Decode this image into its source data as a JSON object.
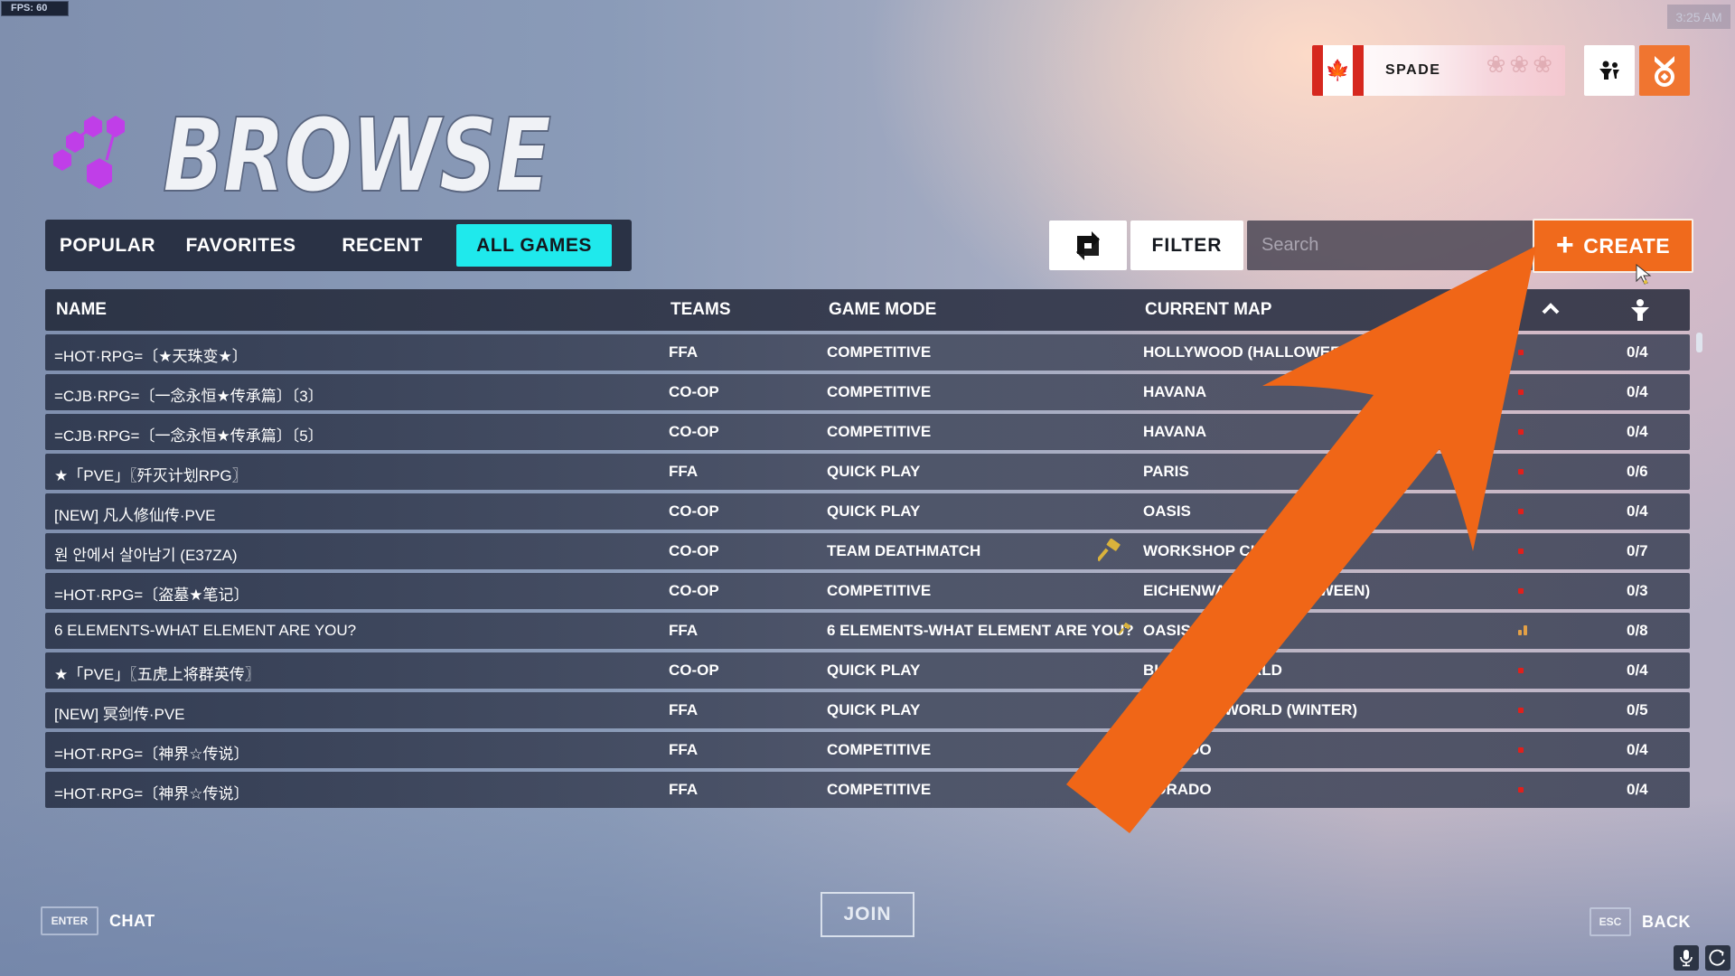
{
  "hud": {
    "fps": "FPS:  60",
    "clock": "3:25 AM"
  },
  "header": {
    "title": "BROWSE"
  },
  "player": {
    "name": "SPADE",
    "flag": "canada-flag"
  },
  "tabs": [
    {
      "label": "POPULAR",
      "active": false
    },
    {
      "label": "FAVORITES",
      "active": false
    },
    {
      "label": "RECENT",
      "active": false
    },
    {
      "label": "ALL GAMES",
      "active": true
    }
  ],
  "toolbar": {
    "filter_label": "FILTER",
    "search_placeholder": "Search",
    "search_value": "",
    "create_label": "CREATE"
  },
  "table": {
    "columns": {
      "name": "NAME",
      "teams": "TEAMS",
      "mode": "GAME MODE",
      "map": "CURRENT MAP"
    },
    "rows": [
      {
        "name": "=HOT·RPG=〔★天珠变★〕",
        "teams": "FFA",
        "mode": "COMPETITIVE",
        "map": "HOLLYWOOD (HALLOWEEN)",
        "ping": "bad",
        "players": "0/4",
        "workshop": false
      },
      {
        "name": "=CJB·RPG=〔一念永恒★传承篇〕〔3〕",
        "teams": "CO-OP",
        "mode": "COMPETITIVE",
        "map": "HAVANA",
        "ping": "bad",
        "players": "0/4",
        "workshop": false
      },
      {
        "name": "=CJB·RPG=〔一念永恒★传承篇〕〔5〕",
        "teams": "CO-OP",
        "mode": "COMPETITIVE",
        "map": "HAVANA",
        "ping": "bad",
        "players": "0/4",
        "workshop": false
      },
      {
        "name": "★「PVE」〖歼灭计划RPG〗",
        "teams": "FFA",
        "mode": "QUICK PLAY",
        "map": "PARIS",
        "ping": "bad",
        "players": "0/6",
        "workshop": false
      },
      {
        "name": "[NEW]  凡人修仙传·PVE",
        "teams": "CO-OP",
        "mode": "QUICK PLAY",
        "map": "OASIS",
        "ping": "bad",
        "players": "0/4",
        "workshop": false
      },
      {
        "name": "원 안에서 살아남기 (E37ZA)",
        "teams": "CO-OP",
        "mode": "TEAM DEATHMATCH",
        "map": "WORKSHOP CHAMBER",
        "ping": "bad",
        "players": "0/7",
        "workshop": true
      },
      {
        "name": "=HOT·RPG=〔盗墓★笔记〕",
        "teams": "CO-OP",
        "mode": "COMPETITIVE",
        "map": "EICHENWALDE (HALLOWEEN)",
        "ping": "bad",
        "players": "0/3",
        "workshop": false
      },
      {
        "name": "6 ELEMENTS-WHAT ELEMENT ARE YOU?",
        "teams": "FFA",
        "mode": "6 ELEMENTS-WHAT ELEMENT ARE YOU?",
        "map": "OASIS",
        "ping": "medium",
        "players": "0/8",
        "workshop": true
      },
      {
        "name": "★「PVE」〖五虎上将群英传〗",
        "teams": "CO-OP",
        "mode": "QUICK PLAY",
        "map": "BLIZZARD WORLD",
        "ping": "bad",
        "players": "0/4",
        "workshop": false
      },
      {
        "name": "[NEW]  冥剑传·PVE",
        "teams": "FFA",
        "mode": "QUICK PLAY",
        "map": "BLIZZARD WORLD (WINTER)",
        "ping": "bad",
        "players": "0/5",
        "workshop": false
      },
      {
        "name": "=HOT·RPG=〔神界☆传说〕",
        "teams": "FFA",
        "mode": "COMPETITIVE",
        "map": "DORADO",
        "ping": "bad",
        "players": "0/4",
        "workshop": false
      },
      {
        "name": "=HOT·RPG=〔神界☆传说〕",
        "teams": "FFA",
        "mode": "COMPETITIVE",
        "map": "DORADO",
        "ping": "bad",
        "players": "0/4",
        "workshop": false
      }
    ]
  },
  "footer": {
    "chat_key": "ENTER",
    "chat_label": "CHAT",
    "join_label": "JOIN",
    "back_key": "ESC",
    "back_label": "BACK"
  },
  "colors": {
    "accent_tab": "#1fe9ec",
    "create": "#f06a1c",
    "annotation_arrow": "#f06617",
    "ping_bad": "#e0201c",
    "ping_medium": "#e3a046",
    "logo": "#c03ee8"
  }
}
